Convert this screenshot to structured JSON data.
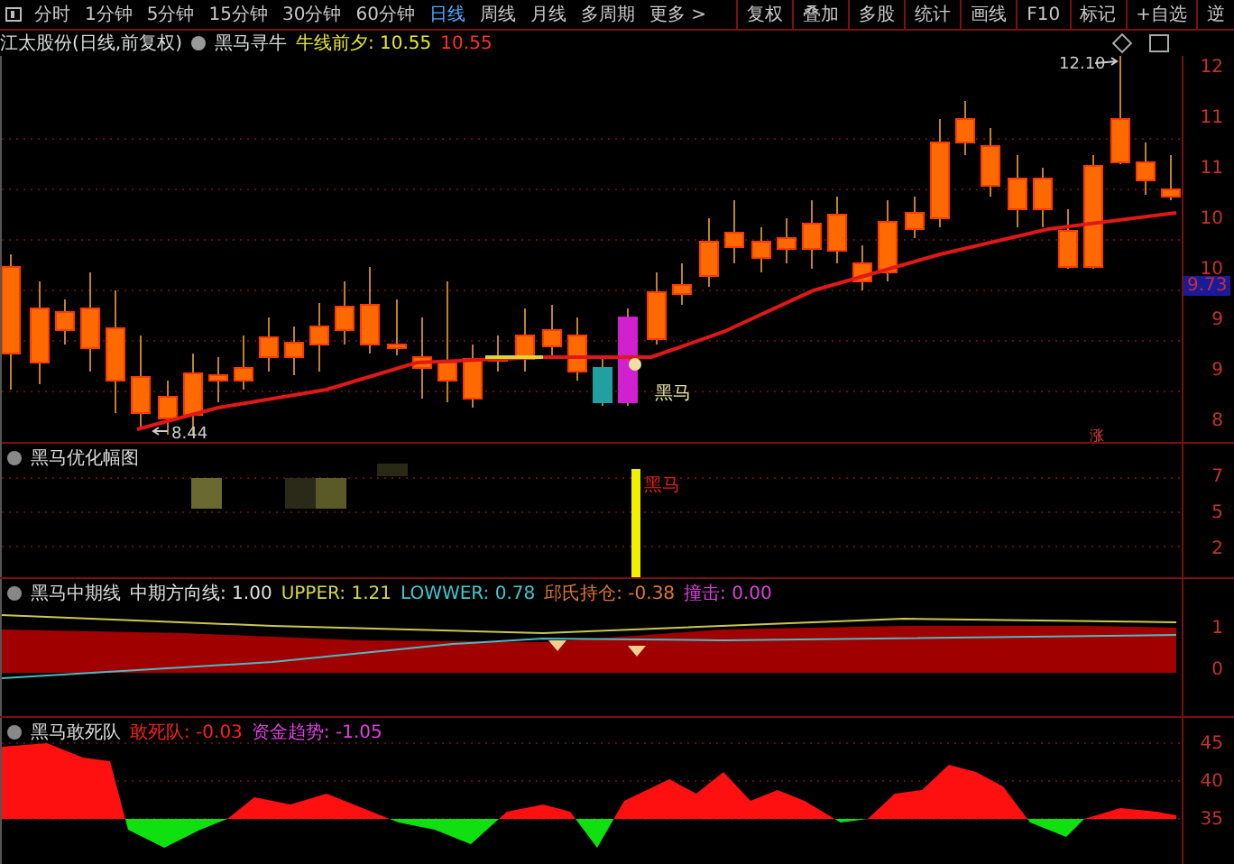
{
  "toolbar": {
    "periods": [
      {
        "label": "分时",
        "selected": false
      },
      {
        "label": "1分钟",
        "selected": false
      },
      {
        "label": "5分钟",
        "selected": false
      },
      {
        "label": "15分钟",
        "selected": false
      },
      {
        "label": "30分钟",
        "selected": false
      },
      {
        "label": "60分钟",
        "selected": false
      },
      {
        "label": "日线",
        "selected": true
      },
      {
        "label": "周线",
        "selected": false
      },
      {
        "label": "月线",
        "selected": false
      },
      {
        "label": "多周期",
        "selected": false
      },
      {
        "label": "更多 >",
        "selected": false
      }
    ],
    "actions": [
      "复权",
      "叠加",
      "多股",
      "统计",
      "画线",
      "F10",
      "标记",
      "+自选",
      "逆"
    ]
  },
  "info_bar": {
    "title": "江太股份(日线,前复权)",
    "indicator": "黑马寻牛",
    "legend": [
      {
        "text": "牛线前夕: 10.55",
        "color": "#e8e830"
      },
      {
        "text": "10.55",
        "color": "#ff3030"
      }
    ]
  },
  "main_panel": {
    "high_label": "12.10",
    "low_label": "8.44",
    "signal_label": "黑马",
    "rise_label": "涨",
    "price_tag": "9.73",
    "axis_labels": [
      "12",
      "11",
      "11",
      "10",
      "10",
      "9",
      "9",
      "8"
    ]
  },
  "panels": [
    {
      "kind": "signal",
      "title": "黑马优化幅图",
      "marker_label": "黑马",
      "axis_labels": [
        "7",
        "5",
        "2"
      ]
    },
    {
      "kind": "band",
      "title": "黑马中期线",
      "legend": [
        {
          "text": "中期方向线: 1.00",
          "color": "#e0e0e0"
        },
        {
          "text": "UPPER: 1.21",
          "color": "#d8d840"
        },
        {
          "text": "LOWWER: 0.78",
          "color": "#40c8d0"
        },
        {
          "text": "邱氏持仓: -0.38",
          "color": "#e07830"
        },
        {
          "text": "撞击: 0.00",
          "color": "#e040e0"
        }
      ],
      "axis_labels": [
        "1",
        "0"
      ]
    },
    {
      "kind": "flow",
      "title": "黑马敢死队",
      "legend": [
        {
          "text": "敢死队: -0.03",
          "color": "#ff2020"
        },
        {
          "text": "资金趋势: -1.05",
          "color": "#e040e0"
        }
      ],
      "axis_labels": [
        "45",
        "40",
        "35"
      ]
    }
  ]
}
